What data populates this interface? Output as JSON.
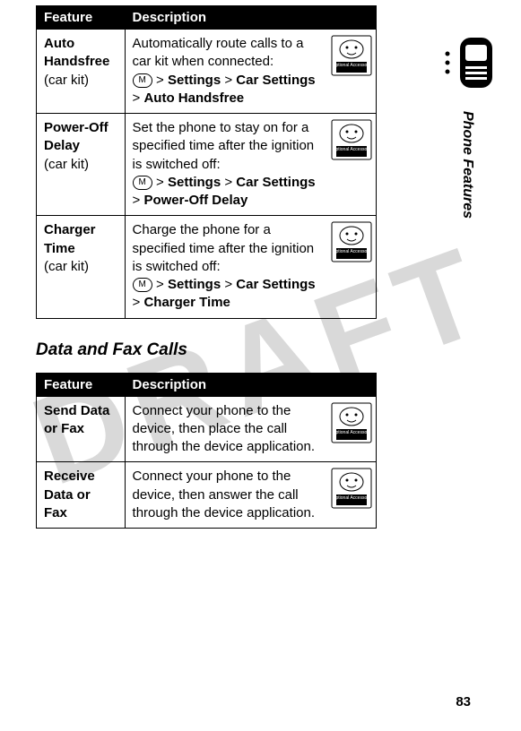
{
  "watermark": "DRAFT",
  "side_section": "Phone Features",
  "page_number": "83",
  "table1": {
    "headers": {
      "feature": "Feature",
      "description": "Description"
    },
    "rows": [
      {
        "name": "Auto Handsfree",
        "sub": "(car kit)",
        "desc": "Automatically route calls to a car kit when connected:",
        "menu1": "Settings",
        "menu2": "Car Settings",
        "menu3": "Auto Handsfree",
        "accessory": "Optional Accessory"
      },
      {
        "name": "Power-Off Delay",
        "sub": "(car kit)",
        "desc": "Set the phone to stay on for a specified time after the ignition is switched off:",
        "menu1": "Settings",
        "menu2": "Car Settings",
        "menu3": "Power-Off Delay",
        "accessory": "Optional Accessory"
      },
      {
        "name": "Charger Time",
        "sub": "(car kit)",
        "desc": "Charge the phone for a specified time after the ignition is switched off:",
        "menu1": "Settings",
        "menu2": "Car Settings",
        "menu3": "Charger Time",
        "accessory": "Optional Accessory"
      }
    ]
  },
  "section_heading": "Data and Fax Calls",
  "table2": {
    "headers": {
      "feature": "Feature",
      "description": "Description"
    },
    "rows": [
      {
        "name": "Send Data or Fax",
        "desc": "Connect your phone to the device, then place the call through the device application.",
        "accessory": "Optional Accessory"
      },
      {
        "name": "Receive Data or Fax",
        "desc": "Connect your phone to the device, then answer the call through the device application.",
        "accessory": "Optional Accessory"
      }
    ]
  },
  "gt": ">",
  "menu_key": "M"
}
